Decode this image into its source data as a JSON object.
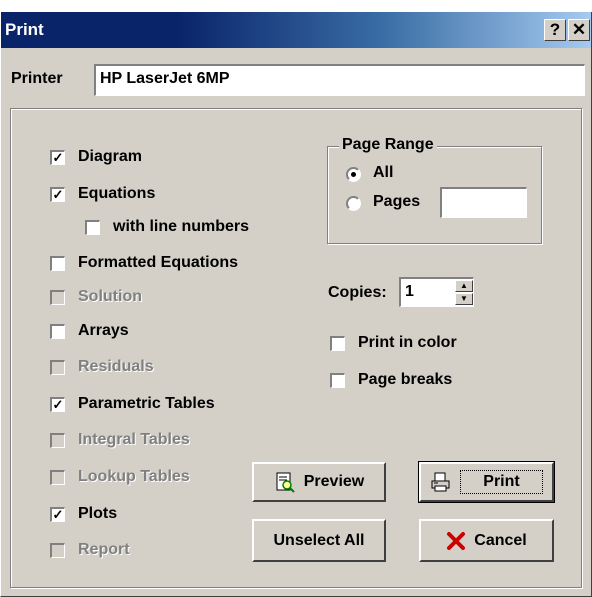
{
  "window": {
    "title": "Print",
    "help_label": "?",
    "close_label": "✕"
  },
  "printer": {
    "label": "Printer",
    "value": "HP LaserJet 6MP"
  },
  "options": [
    {
      "label": "Diagram",
      "checked": true,
      "enabled": true
    },
    {
      "label": "Equations",
      "checked": true,
      "enabled": true
    },
    {
      "label": "with line numbers",
      "checked": false,
      "enabled": true
    },
    {
      "label": "Formatted Equations",
      "checked": false,
      "enabled": true
    },
    {
      "label": "Solution",
      "checked": false,
      "enabled": false
    },
    {
      "label": "Arrays",
      "checked": false,
      "enabled": true
    },
    {
      "label": "Residuals",
      "checked": false,
      "enabled": false
    },
    {
      "label": "Parametric Tables",
      "checked": true,
      "enabled": true
    },
    {
      "label": "Integral Tables",
      "checked": false,
      "enabled": false
    },
    {
      "label": "Lookup Tables",
      "checked": false,
      "enabled": false
    },
    {
      "label": "Plots",
      "checked": true,
      "enabled": true
    },
    {
      "label": "Report",
      "checked": false,
      "enabled": false
    }
  ],
  "page_range": {
    "title": "Page Range",
    "all_label": "All",
    "pages_label": "Pages",
    "pages_value": "",
    "selected": "All"
  },
  "copies": {
    "label": "Copies:",
    "value": "1"
  },
  "print_in_color": {
    "label": "Print in color",
    "checked": false
  },
  "page_breaks": {
    "label": "Page breaks",
    "checked": false
  },
  "buttons": {
    "preview": "Preview",
    "print": "Print",
    "unselect_all": "Unselect All",
    "cancel": "Cancel"
  }
}
